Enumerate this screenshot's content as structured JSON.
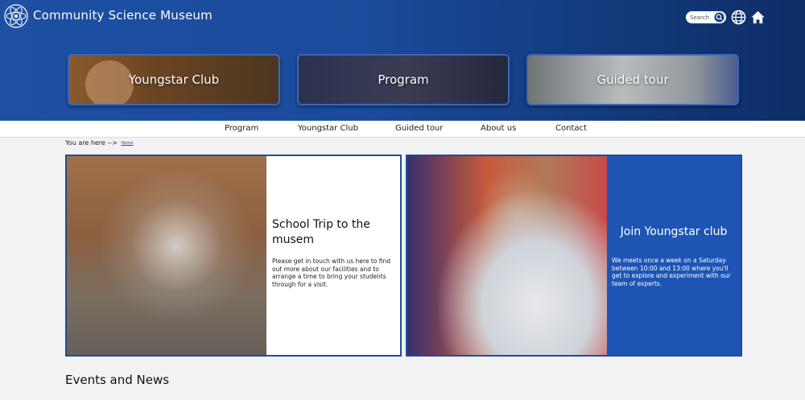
{
  "header": {
    "site_title": "Community Science Museum",
    "search_placeholder": "Search",
    "logo_icon": "atom-logo-icon",
    "globe_icon": "globe-icon",
    "home_icon": "home-icon",
    "brand_color": "#1d4fa3"
  },
  "tiles": [
    {
      "label": "Youngstar Club"
    },
    {
      "label": "Program"
    },
    {
      "label": "Guided tour"
    }
  ],
  "nav": {
    "items": [
      {
        "label": "Program"
      },
      {
        "label": "Youngstar Club"
      },
      {
        "label": "Guided tour"
      },
      {
        "label": "About us"
      },
      {
        "label": "Contact"
      }
    ]
  },
  "breadcrumb": {
    "prefix": "You are here -->",
    "link": "Home"
  },
  "cards": {
    "school": {
      "title": "School Trip to the musem",
      "body": "Please get in touch with us here to find out more about our facilities and to arrange a time to bring your students through for a visit."
    },
    "youngstar": {
      "title": "Join Youngstar club",
      "body": "We meets once a week on a Saturday between 10:00 and 13:00 where you'll get to explore and experiment with our team of experts."
    }
  },
  "events": {
    "heading": "Events and News"
  }
}
